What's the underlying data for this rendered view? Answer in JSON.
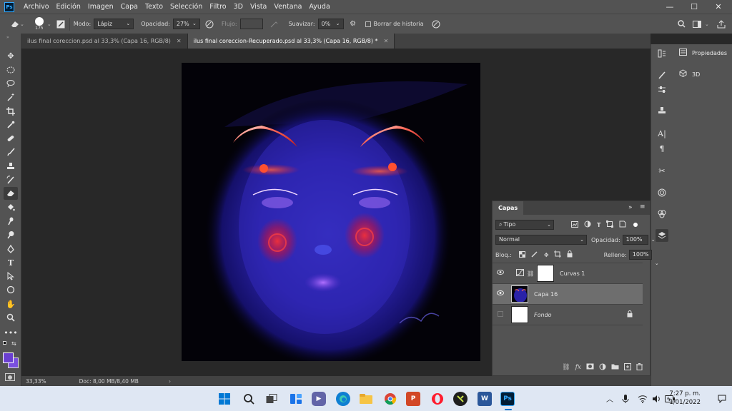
{
  "app": {
    "logo": "Ps"
  },
  "menu": [
    "Archivo",
    "Edición",
    "Imagen",
    "Capa",
    "Texto",
    "Selección",
    "Filtro",
    "3D",
    "Vista",
    "Ventana",
    "Ayuda"
  ],
  "window_controls": {
    "minimize": "—",
    "maximize": "☐",
    "close": "✕"
  },
  "options": {
    "brush_size": "175",
    "mode_label": "Modo:",
    "mode_value": "Lápiz",
    "opacity_label": "Opacidad:",
    "opacity_value": "27%",
    "flow_label": "Flujo:",
    "smooth_label": "Suavizar:",
    "smooth_value": "0%",
    "erase_history_label": "Borrar de historia"
  },
  "tabs": [
    {
      "label": "ilus final coreccion.psd al 33,3% (Capa 16, RGB/8)",
      "active": false
    },
    {
      "label": "ilus final coreccion-Recuperado.psd al 33,3% (Capa 16, RGB/8) *",
      "active": true
    }
  ],
  "status": {
    "zoom": "33,33%",
    "doc": "Doc: 8,00 MB/8,40 MB"
  },
  "right_panel": {
    "properties_label": "Propiedades",
    "threed_label": "3D"
  },
  "layers_panel": {
    "title": "Capas",
    "filter_type": "Tipo",
    "blend_mode": "Normal",
    "opacity_label": "Opacidad:",
    "opacity_value": "100%",
    "lock_label": "Bloq.:",
    "fill_label": "Relleno:",
    "fill_value": "100%",
    "layers": [
      {
        "name": "Curvas 1",
        "visible": true,
        "selected": false,
        "kind": "adjustment"
      },
      {
        "name": "Capa 16",
        "visible": true,
        "selected": true,
        "kind": "pixel"
      },
      {
        "name": "Fondo",
        "visible": false,
        "selected": false,
        "kind": "background",
        "locked": true
      }
    ]
  },
  "taskbar": {
    "time": "7:27 p. m.",
    "date": "1/01/2022"
  },
  "colors": {
    "ui_dark": "#535353",
    "canvas_bg": "#282828",
    "foreground_swatch": "#6a3fd0",
    "background_swatch": "#7a4fe0",
    "ps_accent": "#31a8ff"
  }
}
